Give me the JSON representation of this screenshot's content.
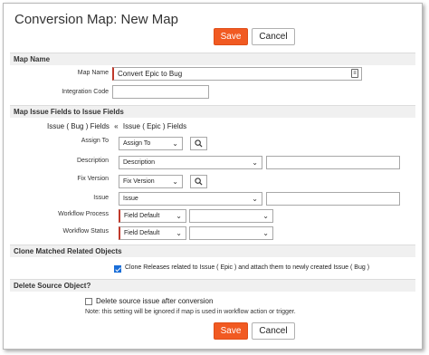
{
  "page": {
    "title": "Conversion Map: New Map"
  },
  "actions": {
    "save_label": "Save",
    "cancel_label": "Cancel"
  },
  "map_name": {
    "section_title": "Map Name",
    "name_label": "Map Name",
    "name_value": "Convert Epic to Bug",
    "integration_label": "Integration Code",
    "integration_value": ""
  },
  "fields": {
    "section_title": "Map Issue Fields to Issue Fields",
    "target_header": "Issue ( Bug ) Fields",
    "arrow": "«",
    "source_header": "Issue ( Epic ) Fields",
    "rows": [
      {
        "label": "Assign To",
        "select": "Assign To",
        "has_search": true
      },
      {
        "label": "Description",
        "select": "Description",
        "text": ""
      },
      {
        "label": "Fix Version",
        "select": "Fix Version",
        "has_search": true
      },
      {
        "label": "Issue",
        "select": "Issue",
        "text": ""
      },
      {
        "label": "Workflow Process",
        "select": "Field Default",
        "select2": ""
      },
      {
        "label": "Workflow Status",
        "select": "Field Default",
        "select2": ""
      }
    ]
  },
  "clone": {
    "section_title": "Clone Matched Related Objects",
    "checkbox_label": "Clone Releases related to Issue ( Epic ) and attach them to newly created Issue ( Bug )",
    "checked": true
  },
  "delete_source": {
    "section_title": "Delete Source Object?",
    "checkbox_label": "Delete source issue after conversion",
    "checked": false,
    "note": "Note: this setting will be ignored if map is used in workflow action or trigger."
  },
  "icons": {
    "search": "search-icon",
    "dropdown": "chevron-down-icon",
    "lookup": "lookup-icon"
  },
  "colors": {
    "accent": "#f15a22",
    "required": "#c0392b",
    "checkbox": "#1a6ed8"
  }
}
